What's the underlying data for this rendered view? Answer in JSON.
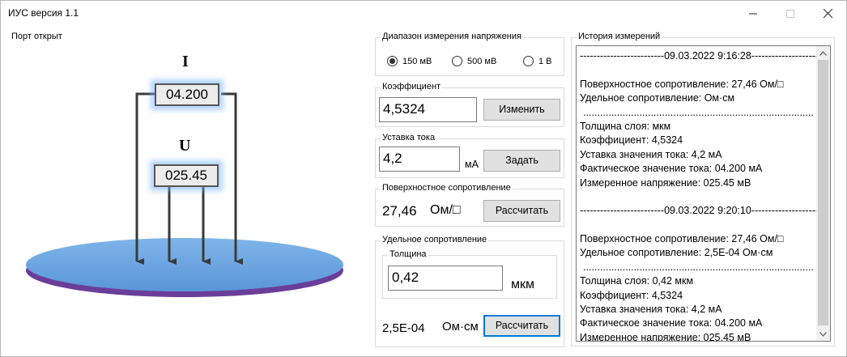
{
  "window": {
    "title": "ИУС версия 1.1"
  },
  "status": "Порт открыт",
  "illustration": {
    "current_symbol": "I",
    "voltage_symbol": "U",
    "current_value": "04.200",
    "voltage_value": "025.45"
  },
  "range_group": {
    "title": "Диапазон измерения напряжения",
    "options": [
      "150 мВ",
      "500 мВ",
      "1 В"
    ],
    "selected": "150 мВ"
  },
  "coef_group": {
    "title": "Коэффициент",
    "value": "4,5324",
    "button": "Изменить"
  },
  "current_group": {
    "title": "Уставка тока",
    "value": "4,2",
    "unit": "мА",
    "button": "Задать"
  },
  "surface_group": {
    "title": "Поверхностное сопротивление",
    "value": "27,46",
    "unit": "Ом/□",
    "button": "Рассчитать"
  },
  "specific_group": {
    "title": "Удельное сопротивление",
    "thickness_title": "Толщина",
    "thickness_value": "0,42",
    "thickness_unit": "мкм",
    "value": "2,5E-04",
    "unit": "Ом·см",
    "button": "Рассчитать"
  },
  "history": {
    "title": "История измерений",
    "lines": [
      "-------------------------09.03.2022 9:16:28-----------------------",
      "",
      "Поверхностное сопротивление: 27,46 Ом/□",
      "Удельное сопротивление:  Ом·см",
      "..................................................................................",
      "Толщина слоя:  мкм",
      "Коэффициент: 4,5324",
      "Уставка значения тока: 4,2 мА",
      "Фактическое значение тока: 04.200 мА",
      "Измеренное напряжение: 025.45 мВ",
      "",
      "-------------------------09.03.2022 9:20:10-----------------------",
      "",
      "Поверхностное сопротивление: 27,46 Ом/□",
      "Удельное сопротивление: 2,5E-04 Ом·см",
      "..................................................................................",
      "Толщина слоя: 0,42 мкм",
      "Коэффициент: 4,5324",
      "Уставка значения тока: 4,2 мА",
      "Фактическое значение тока: 04.200 мА",
      "Измеренное напряжение: 025.45 мВ"
    ]
  }
}
